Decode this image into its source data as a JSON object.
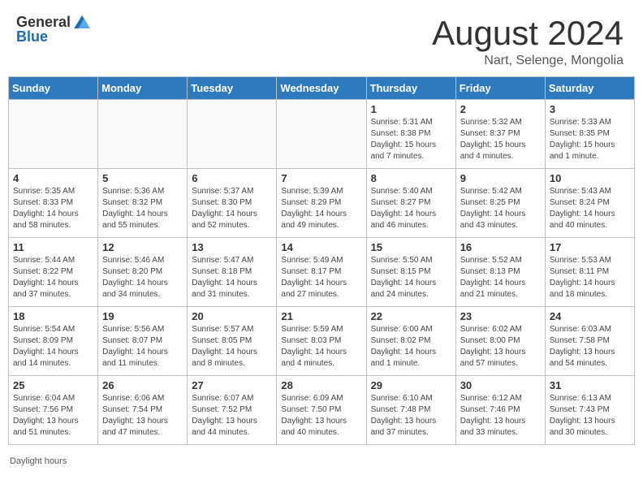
{
  "header": {
    "logo_general": "General",
    "logo_blue": "Blue",
    "month_title": "August 2024",
    "location": "Nart, Selenge, Mongolia"
  },
  "footer": {
    "note": "Daylight hours"
  },
  "weekdays": [
    "Sunday",
    "Monday",
    "Tuesday",
    "Wednesday",
    "Thursday",
    "Friday",
    "Saturday"
  ],
  "weeks": [
    [
      {
        "day": "",
        "info": ""
      },
      {
        "day": "",
        "info": ""
      },
      {
        "day": "",
        "info": ""
      },
      {
        "day": "",
        "info": ""
      },
      {
        "day": "1",
        "info": "Sunrise: 5:31 AM\nSunset: 8:38 PM\nDaylight: 15 hours and 7 minutes."
      },
      {
        "day": "2",
        "info": "Sunrise: 5:32 AM\nSunset: 8:37 PM\nDaylight: 15 hours and 4 minutes."
      },
      {
        "day": "3",
        "info": "Sunrise: 5:33 AM\nSunset: 8:35 PM\nDaylight: 15 hours and 1 minute."
      }
    ],
    [
      {
        "day": "4",
        "info": "Sunrise: 5:35 AM\nSunset: 8:33 PM\nDaylight: 14 hours and 58 minutes."
      },
      {
        "day": "5",
        "info": "Sunrise: 5:36 AM\nSunset: 8:32 PM\nDaylight: 14 hours and 55 minutes."
      },
      {
        "day": "6",
        "info": "Sunrise: 5:37 AM\nSunset: 8:30 PM\nDaylight: 14 hours and 52 minutes."
      },
      {
        "day": "7",
        "info": "Sunrise: 5:39 AM\nSunset: 8:29 PM\nDaylight: 14 hours and 49 minutes."
      },
      {
        "day": "8",
        "info": "Sunrise: 5:40 AM\nSunset: 8:27 PM\nDaylight: 14 hours and 46 minutes."
      },
      {
        "day": "9",
        "info": "Sunrise: 5:42 AM\nSunset: 8:25 PM\nDaylight: 14 hours and 43 minutes."
      },
      {
        "day": "10",
        "info": "Sunrise: 5:43 AM\nSunset: 8:24 PM\nDaylight: 14 hours and 40 minutes."
      }
    ],
    [
      {
        "day": "11",
        "info": "Sunrise: 5:44 AM\nSunset: 8:22 PM\nDaylight: 14 hours and 37 minutes."
      },
      {
        "day": "12",
        "info": "Sunrise: 5:46 AM\nSunset: 8:20 PM\nDaylight: 14 hours and 34 minutes."
      },
      {
        "day": "13",
        "info": "Sunrise: 5:47 AM\nSunset: 8:18 PM\nDaylight: 14 hours and 31 minutes."
      },
      {
        "day": "14",
        "info": "Sunrise: 5:49 AM\nSunset: 8:17 PM\nDaylight: 14 hours and 27 minutes."
      },
      {
        "day": "15",
        "info": "Sunrise: 5:50 AM\nSunset: 8:15 PM\nDaylight: 14 hours and 24 minutes."
      },
      {
        "day": "16",
        "info": "Sunrise: 5:52 AM\nSunset: 8:13 PM\nDaylight: 14 hours and 21 minutes."
      },
      {
        "day": "17",
        "info": "Sunrise: 5:53 AM\nSunset: 8:11 PM\nDaylight: 14 hours and 18 minutes."
      }
    ],
    [
      {
        "day": "18",
        "info": "Sunrise: 5:54 AM\nSunset: 8:09 PM\nDaylight: 14 hours and 14 minutes."
      },
      {
        "day": "19",
        "info": "Sunrise: 5:56 AM\nSunset: 8:07 PM\nDaylight: 14 hours and 11 minutes."
      },
      {
        "day": "20",
        "info": "Sunrise: 5:57 AM\nSunset: 8:05 PM\nDaylight: 14 hours and 8 minutes."
      },
      {
        "day": "21",
        "info": "Sunrise: 5:59 AM\nSunset: 8:03 PM\nDaylight: 14 hours and 4 minutes."
      },
      {
        "day": "22",
        "info": "Sunrise: 6:00 AM\nSunset: 8:02 PM\nDaylight: 14 hours and 1 minute."
      },
      {
        "day": "23",
        "info": "Sunrise: 6:02 AM\nSunset: 8:00 PM\nDaylight: 13 hours and 57 minutes."
      },
      {
        "day": "24",
        "info": "Sunrise: 6:03 AM\nSunset: 7:58 PM\nDaylight: 13 hours and 54 minutes."
      }
    ],
    [
      {
        "day": "25",
        "info": "Sunrise: 6:04 AM\nSunset: 7:56 PM\nDaylight: 13 hours and 51 minutes."
      },
      {
        "day": "26",
        "info": "Sunrise: 6:06 AM\nSunset: 7:54 PM\nDaylight: 13 hours and 47 minutes."
      },
      {
        "day": "27",
        "info": "Sunrise: 6:07 AM\nSunset: 7:52 PM\nDaylight: 13 hours and 44 minutes."
      },
      {
        "day": "28",
        "info": "Sunrise: 6:09 AM\nSunset: 7:50 PM\nDaylight: 13 hours and 40 minutes."
      },
      {
        "day": "29",
        "info": "Sunrise: 6:10 AM\nSunset: 7:48 PM\nDaylight: 13 hours and 37 minutes."
      },
      {
        "day": "30",
        "info": "Sunrise: 6:12 AM\nSunset: 7:46 PM\nDaylight: 13 hours and 33 minutes."
      },
      {
        "day": "31",
        "info": "Sunrise: 6:13 AM\nSunset: 7:43 PM\nDaylight: 13 hours and 30 minutes."
      }
    ]
  ]
}
